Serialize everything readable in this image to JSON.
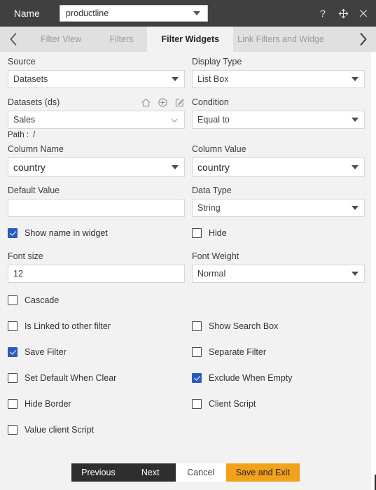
{
  "titlebar": {
    "name_label": "Name",
    "name_value": "productline",
    "icons": [
      {
        "name": "help-icon",
        "glyph": "?"
      },
      {
        "name": "move-icon",
        "glyph": "move"
      },
      {
        "name": "close-icon",
        "glyph": "✕"
      }
    ]
  },
  "tabs": {
    "prev_arrow": "‹",
    "next_arrow": "›",
    "items": [
      {
        "label": "Filter View",
        "active": false
      },
      {
        "label": "Filters",
        "active": false
      },
      {
        "label": "Filter Widgets",
        "active": true
      },
      {
        "label": "Link Filters and Widge",
        "active": false
      }
    ]
  },
  "form": {
    "source": {
      "label": "Source",
      "value": "Datasets"
    },
    "display_type": {
      "label": "Display Type",
      "value": "List Box"
    },
    "datasets": {
      "label": "Datasets (ds)",
      "value": "Sales",
      "icons": [
        {
          "name": "home-icon"
        },
        {
          "name": "add-circle-icon"
        },
        {
          "name": "edit-pencil-icon"
        }
      ],
      "path_label": "Path :",
      "path_value": "/"
    },
    "condition": {
      "label": "Condition",
      "value": "Equal to"
    },
    "column_name": {
      "label": "Column Name",
      "value": "country"
    },
    "column_value": {
      "label": "Column Value",
      "value": "country"
    },
    "default_value": {
      "label": "Default Value",
      "value": "",
      "placeholder": ""
    },
    "data_type": {
      "label": "Data Type",
      "value": "String"
    },
    "font_size": {
      "label": "Font size",
      "value": "12"
    },
    "font_weight": {
      "label": "Font Weight",
      "value": "Normal"
    }
  },
  "checkboxes": {
    "show_name_in_widget": {
      "label": "Show name in widget",
      "checked": true
    },
    "hide": {
      "label": "Hide",
      "checked": false
    },
    "cascade": {
      "label": "Cascade",
      "checked": false
    },
    "is_linked_to_other_filter": {
      "label": "Is Linked to other filter",
      "checked": false
    },
    "show_search_box": {
      "label": "Show Search Box",
      "checked": false
    },
    "save_filter": {
      "label": "Save Filter",
      "checked": true
    },
    "separate_filter": {
      "label": "Separate Filter",
      "checked": false
    },
    "set_default_when_clear": {
      "label": "Set Default When Clear",
      "checked": false
    },
    "exclude_when_empty": {
      "label": "Exclude When Empty",
      "checked": true
    },
    "hide_border": {
      "label": "Hide Border",
      "checked": false
    },
    "client_script": {
      "label": "Client Script",
      "checked": false
    },
    "value_client_script": {
      "label": "Value client Script",
      "checked": false
    }
  },
  "footer": {
    "previous": "Previous",
    "next": "Next",
    "cancel": "Cancel",
    "save_and_exit": "Save and Exit"
  },
  "colors": {
    "titlebar_bg": "#404040",
    "tabbar_bg": "#e0e0e0",
    "active_tab_bg": "#f2f2f2",
    "body_bg": "#f2f2f2",
    "checkbox_checked": "#2c5bbd",
    "accent_button": "#f2a11b",
    "dark_button": "#2e2e2e"
  }
}
